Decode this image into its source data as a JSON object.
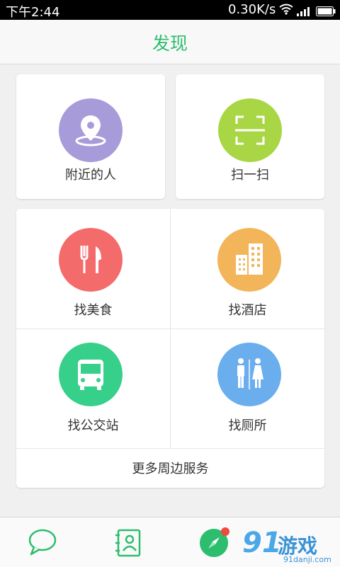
{
  "status_bar": {
    "time": "下午2:44",
    "network_speed": "0.30K/s",
    "wifi_icon": "wifi-icon",
    "signal_icon": "signal-icon",
    "battery_icon": "battery-icon"
  },
  "header": {
    "title": "发现"
  },
  "top_card": {
    "items": [
      {
        "label": "附近的人",
        "icon": "location-pin-icon",
        "color": "#a89bd9"
      },
      {
        "label": "扫一扫",
        "icon": "scan-icon",
        "color": "#a8d645"
      }
    ]
  },
  "services_card": {
    "items": [
      {
        "label": "找美食",
        "icon": "fork-knife-icon",
        "color": "#f46b6b"
      },
      {
        "label": "找酒店",
        "icon": "building-icon",
        "color": "#f2b55a"
      },
      {
        "label": "找公交站",
        "icon": "bus-icon",
        "color": "#36d08a"
      },
      {
        "label": "找厕所",
        "icon": "restroom-icon",
        "color": "#6aaeed"
      }
    ],
    "more_label": "更多周边服务"
  },
  "bottom_nav": {
    "items": [
      {
        "icon": "chat-bubble-icon"
      },
      {
        "icon": "contacts-icon"
      },
      {
        "icon": "compass-icon",
        "has_badge": true
      }
    ]
  },
  "watermark": {
    "big": "91",
    "cn": "游戏",
    "url": "91danji.com"
  },
  "colors": {
    "accent": "#2dbd6e",
    "badge": "#f04a3e"
  }
}
